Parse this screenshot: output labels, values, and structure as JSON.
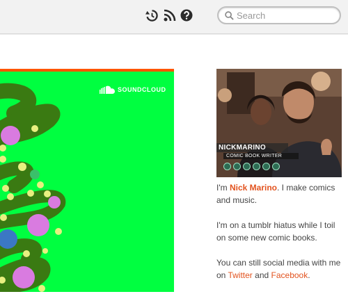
{
  "header": {
    "icons": [
      "history-icon",
      "rss-icon",
      "help-icon"
    ],
    "search": {
      "placeholder": "Search",
      "value": ""
    }
  },
  "player": {
    "brand": "SOUNDCLOUD",
    "accent_color": "#ff5500",
    "background_color": "#00ff40"
  },
  "sidebar": {
    "photo": {
      "name": "NICKMARINO",
      "role": "COMIC BOOK WRITER"
    },
    "bio": {
      "p1_pre": "I'm ",
      "p1_name": "Nick Marino",
      "p1_post": ". I make comics and music.",
      "p2": "I'm on a tumblr hiatus while I toil on some new comic books.",
      "p3_pre": "You can still social media with me on ",
      "p3_link1": "Twitter",
      "p3_mid": " and ",
      "p3_link2": "Facebook",
      "p3_post": "."
    },
    "link_color": "#e2531f"
  }
}
